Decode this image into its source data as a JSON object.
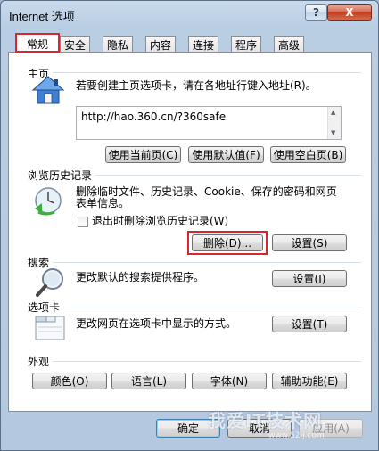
{
  "window": {
    "title": "Internet 选项",
    "help_label": "?",
    "close_label": "X"
  },
  "tabs": [
    {
      "label": "常规",
      "active": true
    },
    {
      "label": "安全"
    },
    {
      "label": "隐私"
    },
    {
      "label": "内容"
    },
    {
      "label": "连接"
    },
    {
      "label": "程序"
    },
    {
      "label": "高级"
    }
  ],
  "home": {
    "section": "主页",
    "description": "若要创建主页选项卡，请在各地址行键入地址(R)。",
    "url": "http://hao.360.cn/?360safe",
    "btn_current": "使用当前页(C)",
    "btn_default": "使用默认值(F)",
    "btn_blank": "使用空白页(B)"
  },
  "history": {
    "section": "浏览历史记录",
    "description_line1": "删除临时文件、历史记录、Cookie、保存的密码和网页",
    "description_line2": "表单信息。",
    "checkbox_label": "退出时删除浏览历史记录(W)",
    "btn_delete": "删除(D)...",
    "btn_settings": "设置(S)"
  },
  "search": {
    "section": "搜索",
    "description": "更改默认的搜索提供程序。",
    "btn_settings": "设置(I)"
  },
  "tabs_section": {
    "section": "选项卡",
    "description": "更改网页在选项卡中显示的方式。",
    "btn_settings": "设置(T)"
  },
  "appearance": {
    "section": "外观",
    "btn_colors": "颜色(O)",
    "btn_languages": "语言(L)",
    "btn_fonts": "字体(N)",
    "btn_accessibility": "辅助功能(E)"
  },
  "footer": {
    "ok": "确定",
    "cancel": "取消",
    "apply": "应用(A)"
  },
  "watermark": {
    "text": "我爱IT技术网",
    "url": "www.52ij.com"
  }
}
